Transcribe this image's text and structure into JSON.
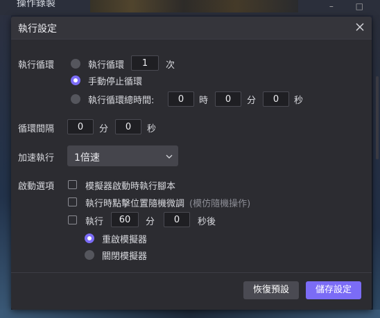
{
  "background": {
    "window_title": "操作錄製"
  },
  "dialog": {
    "title": "執行設定",
    "close_icon": "close-icon"
  },
  "loop": {
    "label": "執行循環",
    "option_count_label": "執行循環",
    "count_value": "1",
    "count_unit": "次",
    "option_manual_label": "手動停止循環",
    "option_duration_label": "執行循環總時間:",
    "duration_hours": "0",
    "hours_unit": "時",
    "duration_minutes": "0",
    "minutes_unit": "分",
    "duration_seconds": "0",
    "seconds_unit": "秒",
    "selected": "manual"
  },
  "interval": {
    "label": "循環間隔",
    "minutes": "0",
    "minutes_unit": "分",
    "seconds": "0",
    "seconds_unit": "秒"
  },
  "speed": {
    "label": "加速執行",
    "selected": "1倍速"
  },
  "startup": {
    "label": "啟動選項",
    "opt1": "模擬器啟動時執行腳本",
    "opt2": "執行時點擊位置隨機微調",
    "opt2_hint": "(模仿隨機操作)",
    "opt3_prefix": "執行",
    "opt3_minutes": "60",
    "opt3_minutes_unit": "分",
    "opt3_seconds": "0",
    "opt3_suffix": "秒後",
    "sub_restart": "重啟模擬器",
    "sub_close": "關閉模擬器",
    "sub_selected": "restart"
  },
  "footer": {
    "reset_label": "恢復預設",
    "save_label": "儲存設定"
  },
  "colors": {
    "accent": "#7b6cf6",
    "dialog_bg": "#2c2c31",
    "header_bg": "#35353b"
  }
}
